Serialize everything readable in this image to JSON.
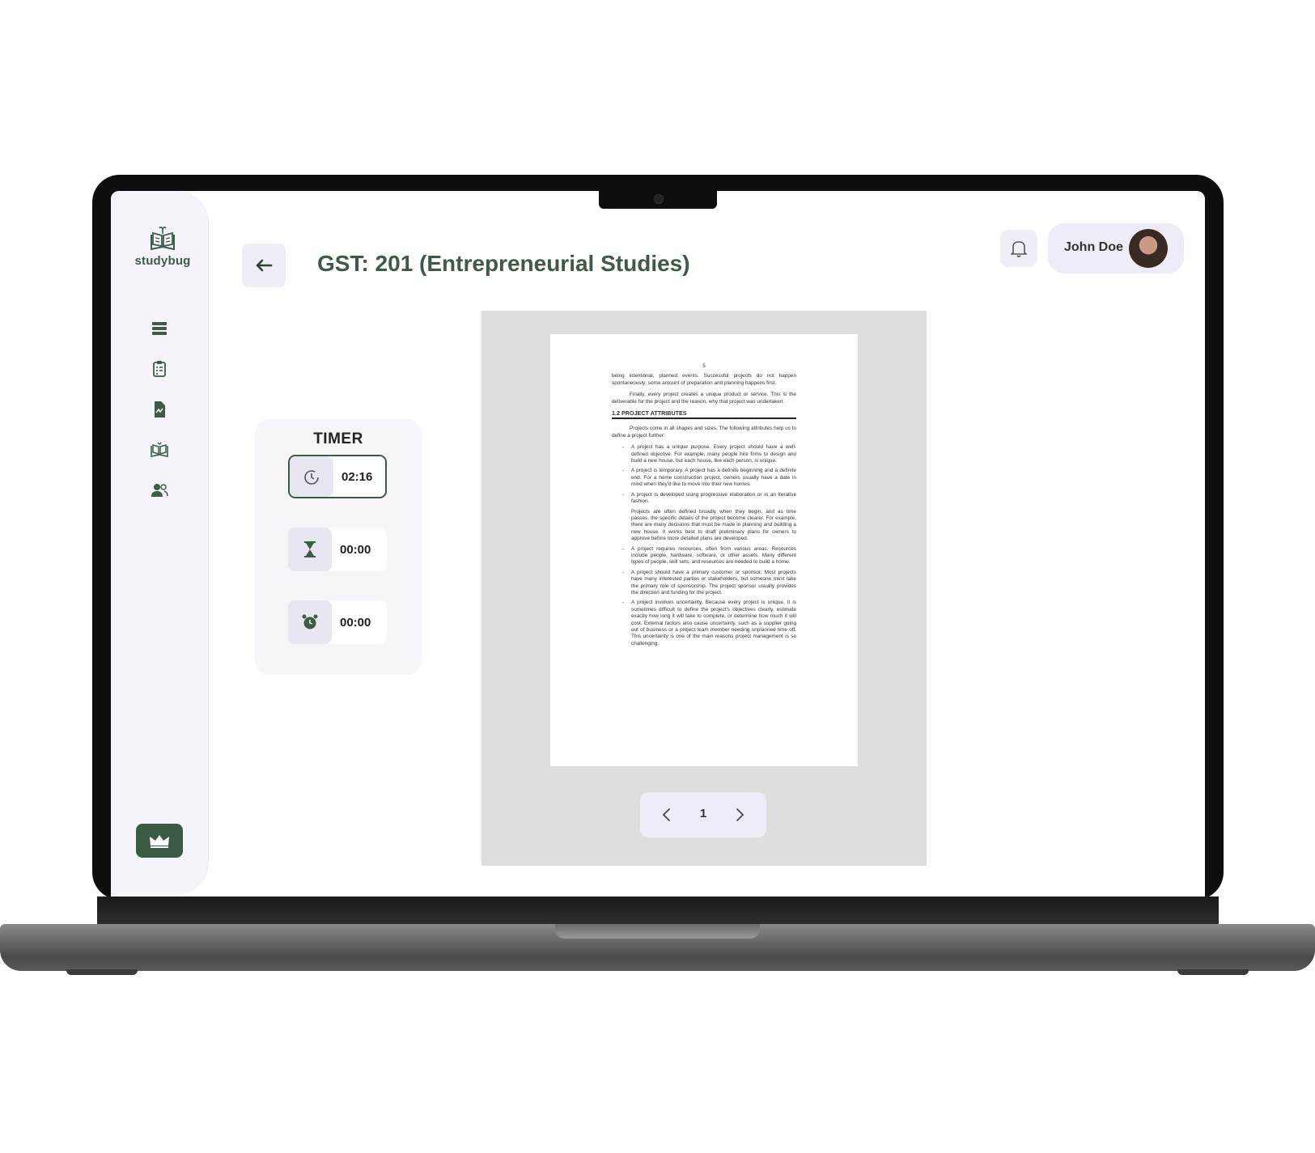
{
  "app": {
    "logo_text": "studybug",
    "page_title": "GST: 201 (Entrepreneurial Studies)"
  },
  "sidebar": {
    "items": [
      {
        "icon": "list-icon"
      },
      {
        "icon": "clipboard-icon"
      },
      {
        "icon": "report-icon"
      },
      {
        "icon": "book-icon"
      },
      {
        "icon": "users-icon"
      }
    ],
    "premium_icon": "crown-icon"
  },
  "header": {
    "user_name": "John Doe"
  },
  "timer": {
    "title": "TIMER",
    "rows": [
      {
        "icon": "stopwatch-icon",
        "value": "02:16",
        "active": true
      },
      {
        "icon": "hourglass-icon",
        "value": "00:00",
        "active": false
      },
      {
        "icon": "alarm-icon",
        "value": "00:00",
        "active": false
      }
    ]
  },
  "document": {
    "page_marker": "5",
    "para1": "being intentional, planned events. Successful projects do not happen spontaneously; some amount of preparation and planning happens first.",
    "para2": "Finally, every project creates a unique product or service. This is the deliverable for the project and the reason, why that project was undertaken.",
    "heading": "1.2 PROJECT ATTRIBUTES",
    "para3": "Projects come in all shapes and sizes. The following attributes help us to define a project further:",
    "bullet1": "A project has a unique purpose. Every project should have a well-defined objective. For example, many people hire firms to design and build a new house, but each house, like each person, is unique.",
    "bullet2": "A project is temporary. A project has a definite beginning and a definite end. For a home construction project, owners usually have a date in mind when they'd like to move into their new homes.",
    "bullet3": "A project is developed using progressive elaboration or in an iterative fashion.",
    "para4": "Projects are often defined broadly when they begin, and as time passes, the specific details of the project become clearer. For example, there are many decisions that must be made in planning and building a new house. It works best to draft preliminary plans for owners to approve before more detailed plans are developed.",
    "bullet4": "A project requires resources, often from various areas. Resources include people, hardware, software, or other assets. Many different types of people, skill sets, and resources are needed to build a home.",
    "bullet5": "A project should have a primary customer or sponsor. Most projects have many interested parties or stakeholders, but someone must take the primary role of sponsorship. The project sponsor usually provides the direction and funding for the project.",
    "bullet6": "A project involves uncertainty. Because every project is unique, it is sometimes difficult to define the project's objectives clearly, estimate exactly how long it will take to complete, or determine how much it will cost. External factors also cause uncertainty, such as a supplier going out of business or a project team member needing unplanned time off. This uncertainty is one of the main reasons project management is so challenging."
  },
  "pager": {
    "current_page": "1"
  },
  "colors": {
    "brand_green": "#3e5b46",
    "sidebar_bg": "#f6f4fb",
    "viewer_bg": "#dedede"
  }
}
